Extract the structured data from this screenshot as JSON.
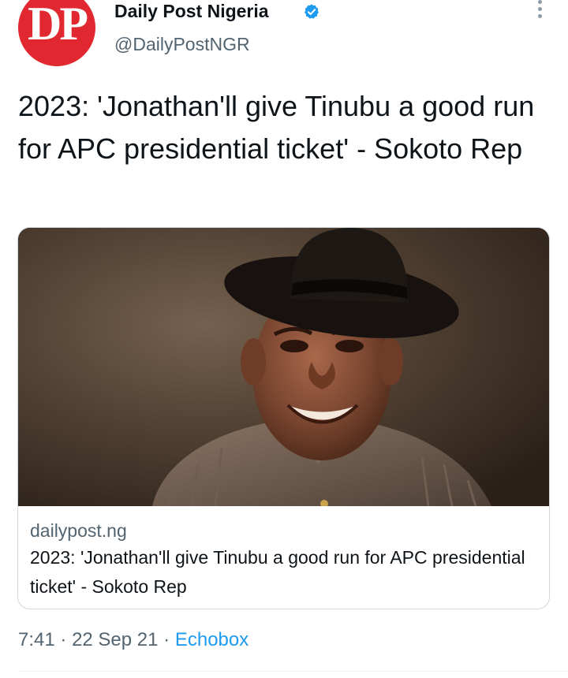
{
  "account": {
    "avatar_text": "DP",
    "name": "Daily Post Nigeria",
    "handle": "@DailyPostNGR",
    "verified_icon": "verified-badge-icon"
  },
  "tweet": {
    "text": "2023: 'Jonathan'll give Tinubu a good run for APC presidential ticket' - Sokoto Rep"
  },
  "card": {
    "image": "portrait-photo",
    "domain": "dailypost.ng",
    "title": "2023: 'Jonathan'll give Tinubu a good run for APC presidential ticket' - Sokoto Rep"
  },
  "meta": {
    "time": "7:41",
    "separator": "·",
    "date": "22 Sep 21",
    "source": "Echobox"
  },
  "colors": {
    "brand_red": "#e1272f",
    "verified_blue": "#1d9bf0",
    "link_blue": "#1d9bf0",
    "secondary_text": "#536471"
  }
}
